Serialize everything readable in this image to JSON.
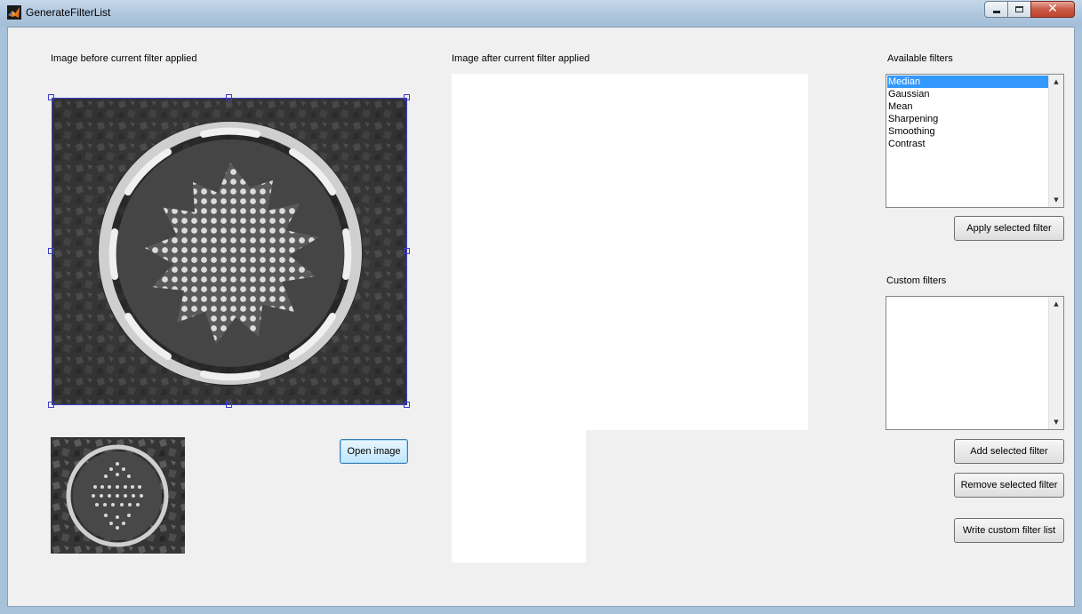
{
  "window": {
    "title": "GenerateFilterList"
  },
  "labels": {
    "before": "Image before current filter applied",
    "after": "Image after current filter applied",
    "available_filters": "Available filters",
    "custom_filters": "Custom filters"
  },
  "buttons": {
    "open_image": "Open image",
    "apply_selected": "Apply selected filter",
    "add_selected": "Add selected filter",
    "remove_selected": "Remove selected filter",
    "write_custom": "Write custom filter list"
  },
  "available_filters": {
    "items": [
      "Median",
      "Gaussian",
      "Mean",
      "Sharpening",
      "Smoothing",
      "Contrast"
    ],
    "selected": "Median"
  },
  "custom_filters": {
    "items": []
  },
  "images": {
    "main": "microscope image of circular diatom with dotted pattern",
    "thumbnail": "thumbnail of circular diatom image"
  },
  "colors": {
    "selection": "#3399ff",
    "handles": "#3d3dcc",
    "background": "#f0f0f0"
  }
}
